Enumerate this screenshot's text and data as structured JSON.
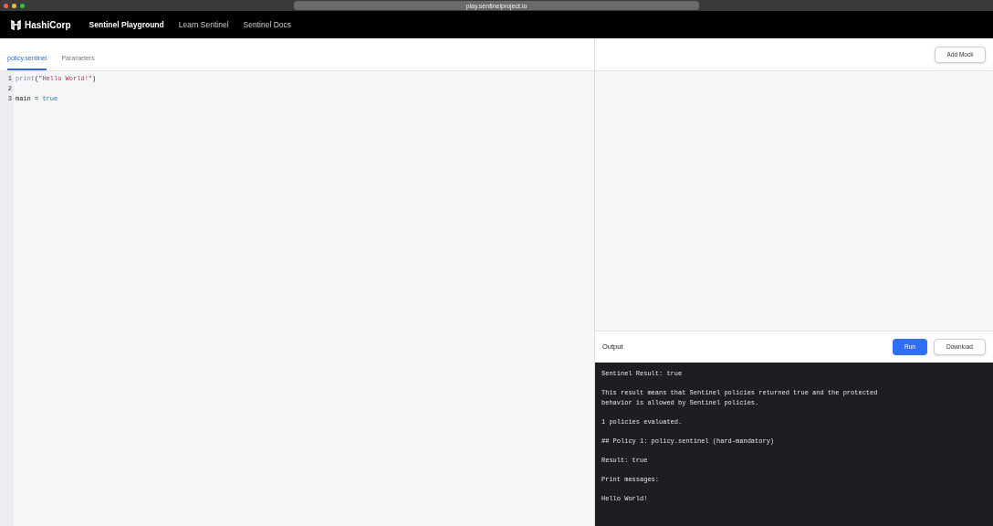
{
  "browser": {
    "url": "play.sentinelproject.io"
  },
  "nav": {
    "logo": "HashiCorp",
    "items": [
      {
        "label": "Sentinel Playground",
        "selected": true
      },
      {
        "label": "Learn Sentinel",
        "selected": false
      },
      {
        "label": "Sentinel Docs",
        "selected": false
      }
    ]
  },
  "tabs": [
    {
      "label": "policy.sentinel",
      "selected": true
    },
    {
      "label": "Parameters",
      "selected": false
    }
  ],
  "editor": {
    "lines": [
      {
        "number": "1",
        "tokens": [
          {
            "text": "print",
            "kind": "func"
          },
          {
            "text": "(",
            "kind": "plain"
          },
          {
            "text": "\"Hello World!\"",
            "kind": "string"
          },
          {
            "text": ")",
            "kind": "plain"
          }
        ]
      },
      {
        "number": "2"
      },
      {
        "number": "3",
        "tokens": [
          {
            "text": "main = ",
            "kind": "plain"
          },
          {
            "text": "true",
            "kind": "keyword"
          }
        ]
      }
    ]
  },
  "mocks": {
    "button": "Add Mock"
  },
  "output": {
    "title": "Output",
    "run_button": "Run",
    "download_button": "Download",
    "paragraphs": [
      {
        "lines": [
          "Sentinel Result: true"
        ]
      },
      {
        "lines": [
          "This result means that Sentinel policies returned true and the protected",
          "behavior is allowed by Sentinel policies."
        ]
      },
      {
        "lines": [
          "1 policies evaluated."
        ]
      },
      {
        "lines": [
          "## Policy 1: policy.sentinel (hard-mandatory)"
        ]
      },
      {
        "lines": [
          "Result: true"
        ]
      },
      {
        "lines": [
          "Print messages:"
        ]
      },
      {
        "lines": [
          "Hello World!"
        ]
      }
    ]
  }
}
